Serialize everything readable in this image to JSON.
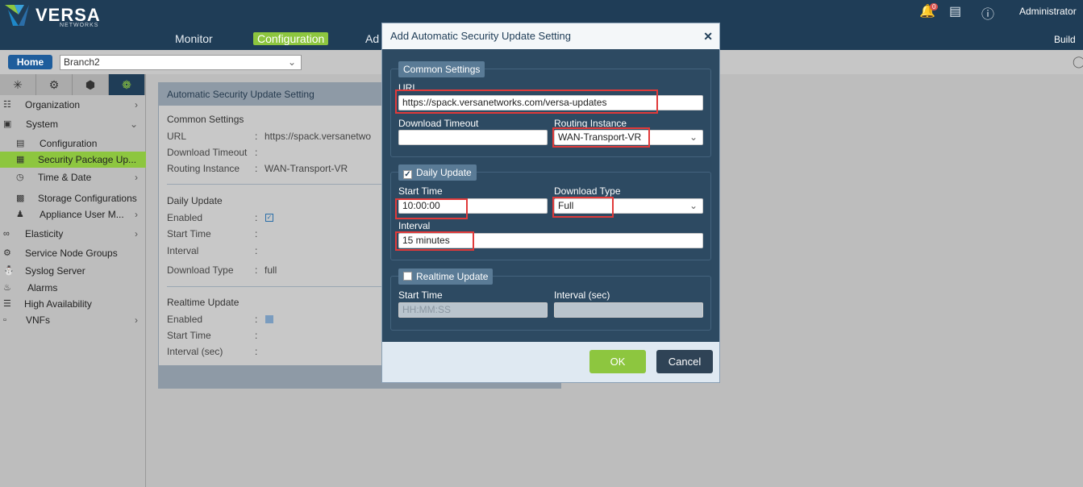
{
  "app": {
    "logo_text": "VERSA",
    "logo_sub": "NETWORKS",
    "user": "Administrator",
    "notification_count": "0",
    "build_label": "Build"
  },
  "nav": {
    "monitor": "Monitor",
    "configuration": "Configuration",
    "admin_partial": "Ad"
  },
  "subbar": {
    "home": "Home",
    "branch": "Branch2"
  },
  "sidebar": {
    "tabs": [
      "tab-1",
      "tab-2",
      "tab-3",
      "tab-4"
    ],
    "items": [
      {
        "label": "Organization",
        "icon": "org-icon"
      },
      {
        "label": "System",
        "icon": "system-icon"
      },
      {
        "label": "Configuration",
        "icon": "configuration-icon"
      },
      {
        "label": "Security Package Up...",
        "icon": "security-package-icon"
      },
      {
        "label": "Time & Date",
        "icon": "clock-icon"
      },
      {
        "label": "Storage Configurations",
        "icon": "storage-icon"
      },
      {
        "label": "Appliance User M...",
        "icon": "users-icon"
      },
      {
        "label": "Elasticity",
        "icon": "elasticity-icon"
      },
      {
        "label": "Service Node Groups",
        "icon": "service-node-icon"
      },
      {
        "label": "Syslog Server",
        "icon": "syslog-icon"
      },
      {
        "label": "Alarms",
        "icon": "alarm-icon"
      },
      {
        "label": "High Availability",
        "icon": "ha-icon"
      },
      {
        "label": "VNFs",
        "icon": "vnf-icon"
      }
    ]
  },
  "background_panel": {
    "title": "Automatic Security Update Setting",
    "common_settings": "Common Settings",
    "url_label": "URL",
    "url_value": "https://spack.versanetwo",
    "download_timeout_label": "Download Timeout",
    "routing_instance_label": "Routing Instance",
    "routing_instance_value": "WAN-Transport-VR",
    "daily_update": "Daily Update",
    "enabled_label": "Enabled",
    "start_time_label": "Start Time",
    "interval_label": "Interval",
    "download_type_label": "Download Type",
    "download_type_value": "full",
    "realtime_update": "Realtime Update",
    "enabled_label_2": "Enabled",
    "start_time_label_2": "Start Time",
    "interval_sec_label": "Interval (sec)",
    "colon": ":"
  },
  "modal": {
    "title": "Add Automatic Security Update Setting",
    "common_settings": "Common Settings",
    "url_label": "URL",
    "url_value": "https://spack.versanetworks.com/versa-updates",
    "download_timeout_label": "Download Timeout",
    "download_timeout_value": "",
    "routing_instance_label": "Routing Instance",
    "routing_instance_value": "WAN-Transport-VR",
    "daily_update": "Daily Update",
    "daily_update_checked": true,
    "start_time_label": "Start Time",
    "start_time_value": "10:00:00",
    "download_type_label": "Download Type",
    "download_type_value": "Full",
    "interval_label": "Interval",
    "interval_value": "15 minutes",
    "realtime_update": "Realtime Update",
    "realtime_checked": false,
    "rt_start_time_label": "Start Time",
    "rt_start_time_placeholder": "HH:MM:SS",
    "rt_interval_label": "Interval (sec)",
    "ok": "OK",
    "cancel": "Cancel"
  },
  "colors": {
    "header": "#1f3d57",
    "accent": "#8dc63f",
    "modal_bg": "#2d4a62",
    "highlight_box": "#e03a3a"
  }
}
